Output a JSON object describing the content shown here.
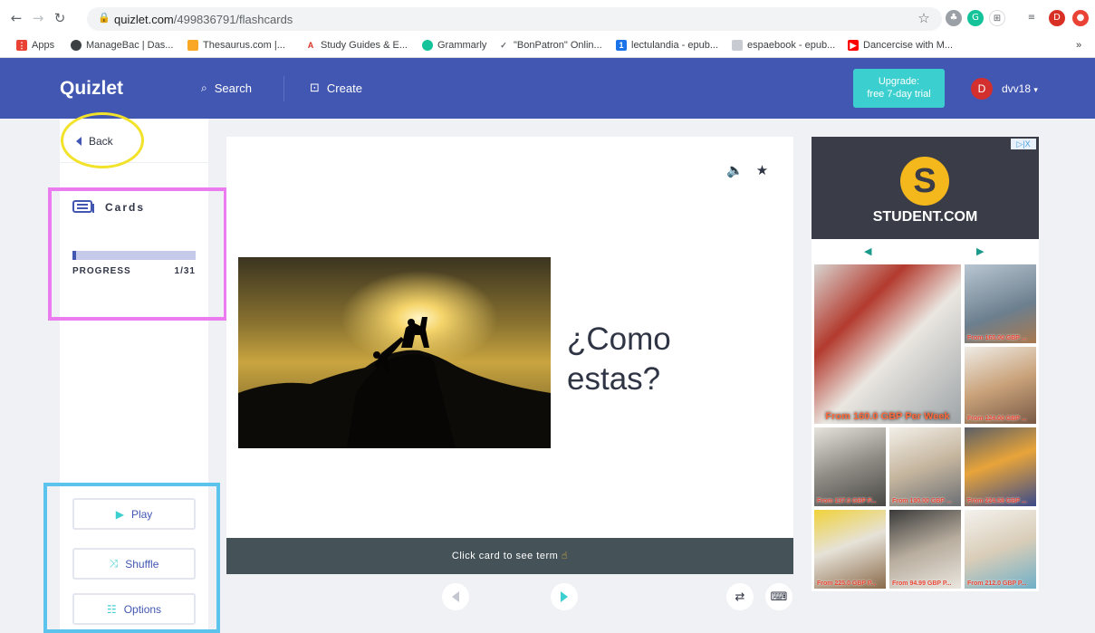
{
  "browser": {
    "url_host": "quizlet.com",
    "url_path": "/499836791/flashcards",
    "bookmarks": [
      {
        "label": "Apps",
        "icon": "apps-grid-icon",
        "color": "#e94235"
      },
      {
        "label": "ManageBac | Das...",
        "icon": "managebac-icon",
        "color": "#3c4043"
      },
      {
        "label": "Thesaurus.com |...",
        "icon": "thesaurus-icon",
        "color": "#f9a825"
      },
      {
        "label": "Study Guides & E...",
        "icon": "study-guides-icon",
        "color": "#d93025"
      },
      {
        "label": "Grammarly",
        "icon": "grammarly-icon",
        "color": "#15c39a"
      },
      {
        "label": "\"BonPatron\" Onlin...",
        "icon": "bonpatron-icon",
        "color": "#5f6368"
      },
      {
        "label": "lectulandia - epub...",
        "icon": "lectulandia-icon",
        "color": "#1a73e8"
      },
      {
        "label": "espaebook - epub...",
        "icon": "espaebook-icon",
        "color": "#9aa0a6"
      },
      {
        "label": "Dancercise with M...",
        "icon": "youtube-icon",
        "color": "#ff0000"
      }
    ],
    "overflow": "»"
  },
  "header": {
    "logo": "Quizlet",
    "search_label": "Search",
    "create_label": "Create",
    "upgrade_line1": "Upgrade:",
    "upgrade_line2": "free 7-day trial",
    "avatar_initial": "D",
    "username": "dvv18"
  },
  "sidebar": {
    "back_label": "Back",
    "mode_label": "Cards",
    "progress_label": "PROGRESS",
    "progress_count": "1/31",
    "progress_fraction": 0.032,
    "play_label": "Play",
    "shuffle_label": "Shuffle",
    "options_label": "Options"
  },
  "card": {
    "text_line1": "¿Como",
    "text_line2": "estas?",
    "hint": "Click card to see term"
  },
  "ad": {
    "brand": "STUDENT.COM",
    "badge": "▷|X",
    "tiles": [
      "From 160.0 GBP Per Week",
      "From 165.00 GBP ...",
      "From 124.00 GBP ...",
      "From 137.0 GBP P...",
      "From 190.00 GBP ...",
      "From 224.58 GBP ...",
      "From 225.0 GBP P...",
      "From 94.99 GBP P...",
      "From 212.0 GBP P..."
    ]
  },
  "colors": {
    "brand": "#4257b2",
    "accent": "#3ccfcf"
  }
}
